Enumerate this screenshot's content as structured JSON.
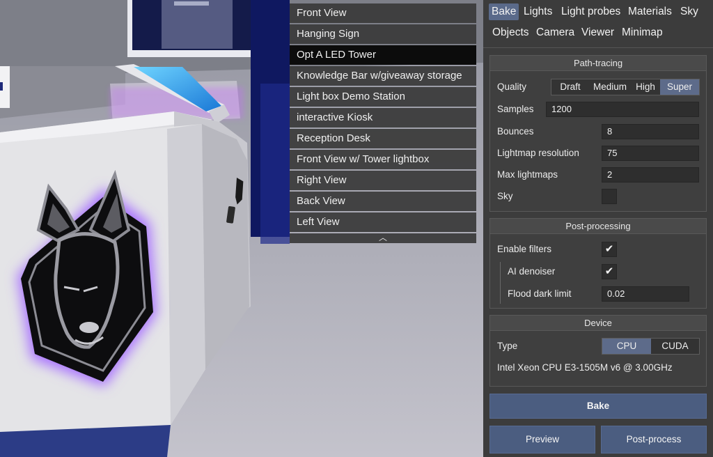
{
  "camera_views": [
    {
      "label": "Front View",
      "active": false
    },
    {
      "label": "Hanging Sign",
      "active": false
    },
    {
      "label": "Opt A LED Tower",
      "active": true
    },
    {
      "label": "Knowledge Bar w/giveaway storage",
      "active": false
    },
    {
      "label": "Light box Demo Station",
      "active": false
    },
    {
      "label": "interactive Kiosk",
      "active": false
    },
    {
      "label": "Reception Desk",
      "active": false
    },
    {
      "label": "Front View w/ Tower lightbox",
      "active": false
    },
    {
      "label": "Right View",
      "active": false
    },
    {
      "label": "Back View",
      "active": false
    },
    {
      "label": "Left View",
      "active": false
    }
  ],
  "collapse_glyph": "︿",
  "tabs": {
    "bake": "Bake",
    "lights": "Lights",
    "light_probes": "Light probes",
    "materials": "Materials",
    "sky": "Sky",
    "objects": "Objects",
    "camera": "Camera",
    "viewer": "Viewer",
    "minimap": "Minimap",
    "active": "bake"
  },
  "path_tracing": {
    "title": "Path-tracing",
    "quality_label": "Quality",
    "quality_options": [
      "Draft",
      "Medium",
      "High",
      "Super"
    ],
    "quality_selected": "Super",
    "samples_label": "Samples",
    "samples_value": "1200",
    "bounces_label": "Bounces",
    "bounces_value": "8",
    "lightmap_resolution_label": "Lightmap resolution",
    "lightmap_resolution_value": "75",
    "max_lightmaps_label": "Max lightmaps",
    "max_lightmaps_value": "2",
    "sky_label": "Sky",
    "sky_checked": false
  },
  "post_processing": {
    "title": "Post-processing",
    "enable_filters_label": "Enable filters",
    "enable_filters_checked": true,
    "ai_denoiser_label": "AI denoiser",
    "ai_denoiser_checked": true,
    "flood_dark_limit_label": "Flood dark limit",
    "flood_dark_limit_value": "0.02",
    "check_glyph": "✔"
  },
  "device": {
    "title": "Device",
    "type_label": "Type",
    "type_options": [
      "CPU",
      "CUDA"
    ],
    "type_selected": "CPU",
    "device_name": "Intel Xeon CPU E3-1505M v6 @ 3.00GHz"
  },
  "actions": {
    "bake": "Bake",
    "preview": "Preview",
    "post_process": "Post-process"
  },
  "colors": {
    "accent": "#4b5d80",
    "selected_segment": "#5d6b8a",
    "panel_bg": "#3c3c3c",
    "glow": "#9b6cff"
  }
}
